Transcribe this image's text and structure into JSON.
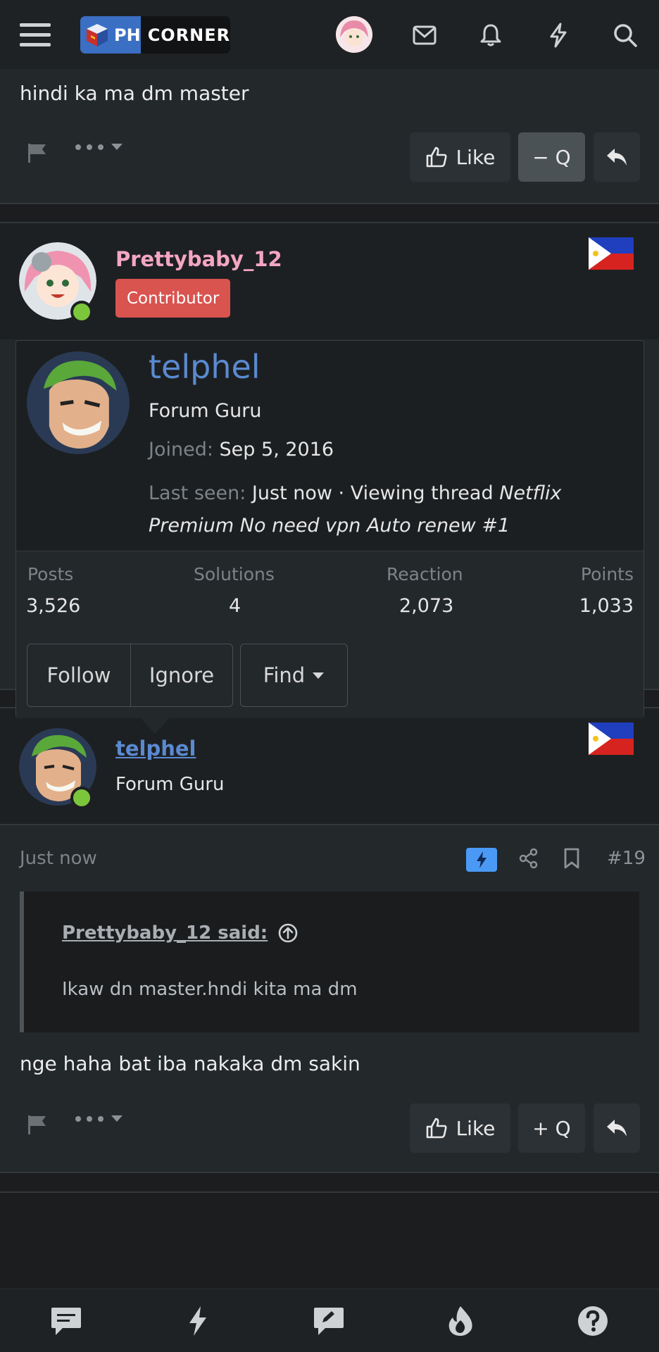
{
  "header": {
    "logo_ph": "PH",
    "logo_corner": "CORNER"
  },
  "post_top": {
    "text": "hindi ka ma dm master",
    "like_label": "Like",
    "quote_label": "− Q"
  },
  "user1": {
    "name": "Prettybaby_12",
    "badge": "Contributor"
  },
  "popup": {
    "name": "telphel",
    "title": "Forum Guru",
    "joined_label": "Joined:",
    "joined_value": "Sep 5, 2016",
    "last_seen_label": "Last seen:",
    "last_seen_value": "Just now · Viewing thread",
    "thread_line1": "Netflix",
    "thread_line2": "Premium No need vpn Auto renew #1",
    "stats": [
      {
        "label": "Posts",
        "value": "3,526"
      },
      {
        "label": "Solutions",
        "value": "4"
      },
      {
        "label": "Reaction",
        "value": "2,073"
      },
      {
        "label": "Points",
        "value": "1,033"
      }
    ],
    "follow_label": "Follow",
    "ignore_label": "Ignore",
    "find_label": "Find"
  },
  "user2": {
    "name": "telphel",
    "title": "Forum Guru"
  },
  "post2": {
    "time": "Just now",
    "number": "#19",
    "quote_author": "Prettybaby_12 said:",
    "quote_text": "Ikaw dn master.hndi kita ma dm",
    "text": "nge haha bat iba nakaka dm sakin",
    "like_label": "Like",
    "quote_label": "+ Q"
  },
  "colors": {
    "background": "#1b1d1f",
    "post_bg": "#23282b",
    "username_pink": "#f4a6c2",
    "badge_red": "#d9534f",
    "link_blue": "#5a8ad1",
    "online_green": "#7cc63b",
    "flash_blue": "#4a9af5"
  }
}
